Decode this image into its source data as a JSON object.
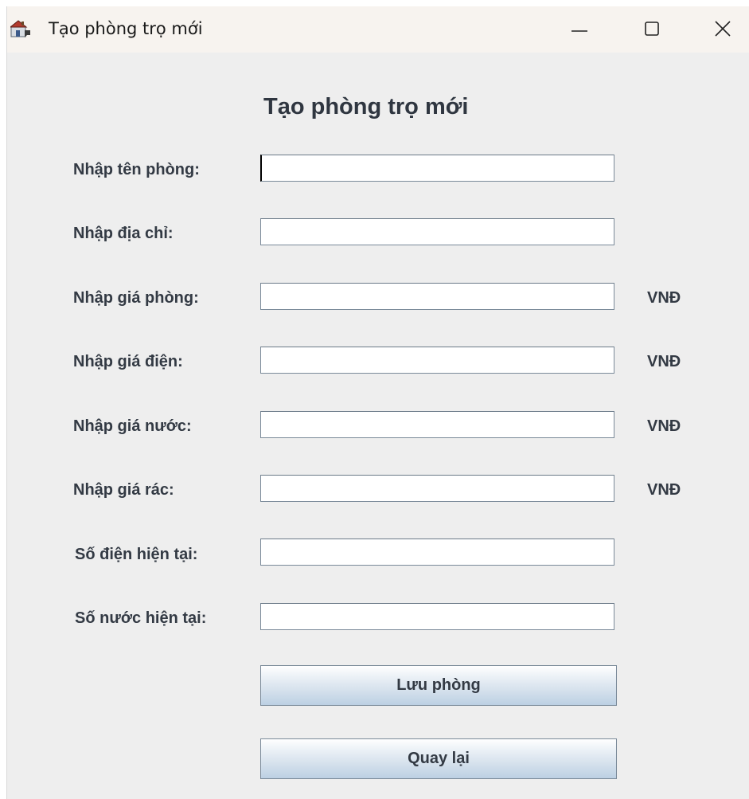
{
  "window": {
    "title": "Tạo phòng trọ mới"
  },
  "form": {
    "heading": "Tạo phòng trọ mới",
    "fields": [
      {
        "label": "Nhập tên phòng:",
        "value": "",
        "unit": ""
      },
      {
        "label": "Nhập địa chỉ:",
        "value": "",
        "unit": ""
      },
      {
        "label": "Nhập giá phòng:",
        "value": "",
        "unit": "VNĐ"
      },
      {
        "label": "Nhập giá điện:",
        "value": "",
        "unit": "VNĐ"
      },
      {
        "label": "Nhập giá nước:",
        "value": "",
        "unit": "VNĐ"
      },
      {
        "label": "Nhập giá rác:",
        "value": "",
        "unit": "VNĐ"
      },
      {
        "label": "Số điện hiện tại:",
        "value": "",
        "unit": ""
      },
      {
        "label": "Số nước hiện tại:",
        "value": "",
        "unit": ""
      }
    ],
    "save_label": "Lưu phòng",
    "back_label": "Quay lại"
  }
}
